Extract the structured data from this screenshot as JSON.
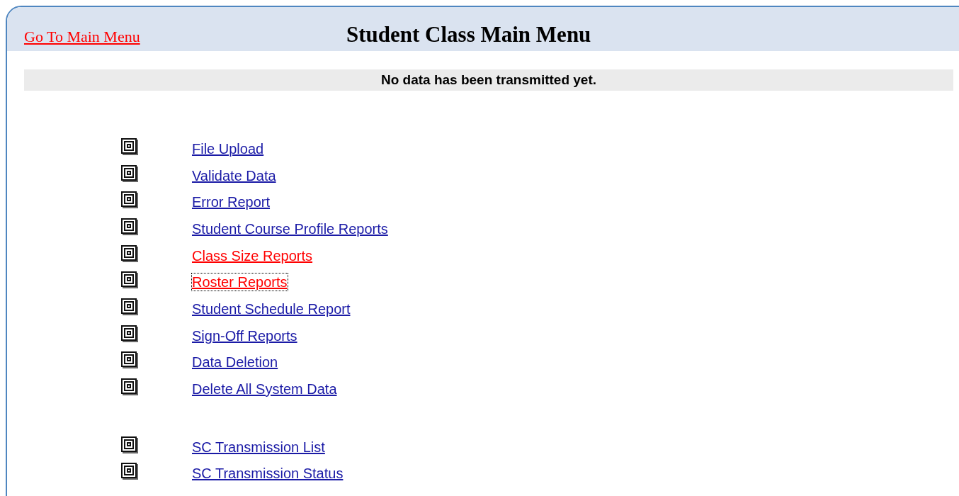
{
  "header": {
    "back_link": "Go To Main Menu",
    "title": "Student Class Main Menu"
  },
  "status_message": "No data has been transmitted yet.",
  "menu_groups": [
    {
      "items": [
        {
          "label": "File Upload",
          "visited": false,
          "focused": false
        },
        {
          "label": "Validate Data",
          "visited": false,
          "focused": false
        },
        {
          "label": "Error Report",
          "visited": false,
          "focused": false
        },
        {
          "label": "Student Course Profile Reports",
          "visited": false,
          "focused": false
        },
        {
          "label": "Class Size Reports",
          "visited": true,
          "focused": false
        },
        {
          "label": "Roster Reports",
          "visited": true,
          "focused": true
        },
        {
          "label": "Student Schedule Report",
          "visited": false,
          "focused": false
        },
        {
          "label": "Sign-Off Reports",
          "visited": false,
          "focused": false
        },
        {
          "label": "Data Deletion",
          "visited": false,
          "focused": false
        },
        {
          "label": "Delete All System Data",
          "visited": false,
          "focused": false
        }
      ]
    },
    {
      "items": [
        {
          "label": "SC Transmission List",
          "visited": false,
          "focused": false
        },
        {
          "label": "SC Transmission Status",
          "visited": false,
          "focused": false
        }
      ]
    }
  ]
}
